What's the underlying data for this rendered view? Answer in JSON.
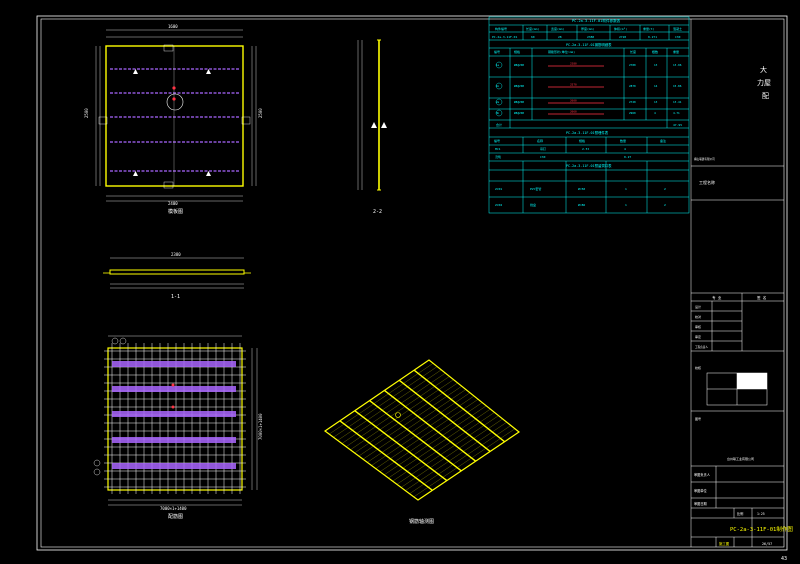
{
  "sheet": {
    "page_number": "43",
    "drawing_code": "PC-2a-3-11F-01",
    "drawing_title": "PC-2a-3-11F-01制作图",
    "scale": "1:25",
    "sheet_no": "26/57",
    "design_stage": "施工图",
    "stamp": "台州联工业有限公司",
    "right_title": [
      "大",
      "力屋",
      "配"
    ],
    "company_short": "横山联建有限公司",
    "project_label": "工程名称",
    "col_left": "专 业",
    "col_right": "签 名",
    "row_labels": [
      "设计",
      "校对",
      "审核",
      "审定",
      "工程负责人"
    ],
    "lower_labels": [
      "审图负责人",
      "审图单位",
      "审图日期"
    ],
    "legend_label": "校核",
    "scale_label": "比例",
    "blank_label": "图号"
  },
  "views": {
    "plan": "模板图",
    "section_1": "1-1",
    "section_2": "2-2",
    "rebar_plan": "配筋图",
    "iso_view": "钢筋轴测图"
  },
  "dims": {
    "plan_top": "1600",
    "plan_bottom": "2400",
    "plan_left": "2500",
    "plan_right": "2500",
    "section_1": "2380",
    "rebar_right": "7000×1+1400",
    "rebar_bottom": "7000×1+1400"
  },
  "table_main": {
    "title": "PC-2a-3-11F-01构件参数表",
    "headers": [
      "构件编号",
      "长度(mm)",
      "宽度(mm)",
      "厚度(mm)",
      "体积(m³)",
      "重量(t)",
      "混凝土"
    ],
    "row": [
      "PC-2a-3-11F-01",
      "60",
      "28",
      "2380",
      "2720",
      "0.271",
      "C30"
    ]
  },
  "table_rebar": {
    "title": "PC-2a-3-11F-01钢筋明细表",
    "headers": [
      "编号",
      "规格",
      "钢筋形状(单位:mm)",
      "长度",
      "根数",
      "重量"
    ],
    "rows": [
      {
        "id": "1a",
        "spec": "Ø8@200",
        "shape": "2380",
        "len": "2780",
        "n": "13",
        "w": "13.96"
      },
      {
        "id": "1b",
        "spec": "Ø8@200",
        "shape": "2570",
        "len": "2870",
        "n": "14",
        "w": "15.86"
      },
      {
        "id": "2a",
        "spec": "Ø8@200",
        "shape": "2600",
        "len": "2720",
        "n": "13",
        "w": "13.41"
      },
      {
        "id": "3b",
        "spec": "Ø8@200",
        "shape": "2660",
        "len": "2960",
        "n": "4",
        "w": "4.71"
      }
    ],
    "total_label": "合计",
    "total": "47.95"
  },
  "table_concrete": {
    "title": "PC-2a-3-11F-01预埋件表",
    "headers": [
      "编号",
      "名称",
      "规格",
      "数量",
      "备注"
    ],
    "rows": [
      [
        "MJ1",
        "吊钉",
        "2.5t",
        "4",
        ""
      ],
      [
        "浇筑",
        "C30",
        "",
        "0.27",
        ""
      ]
    ]
  },
  "table_parts": {
    "title": "PC-2a-3-11F-01预留洞口表",
    "headers": [
      "",
      "",
      "",
      "",
      ""
    ],
    "rows": [
      [
        "ZJ01",
        "PVC套管",
        "Ø=50",
        "1",
        "2"
      ],
      [
        "ZJ02",
        "线盒",
        "Ø=86",
        "1",
        "2"
      ]
    ]
  },
  "colors": {
    "outline": "#ffffff",
    "edge": "#ffff00",
    "table": "#00ffff",
    "rebar": "#aa66ff",
    "marker": "#ff3344",
    "dim": "#00ff66"
  }
}
